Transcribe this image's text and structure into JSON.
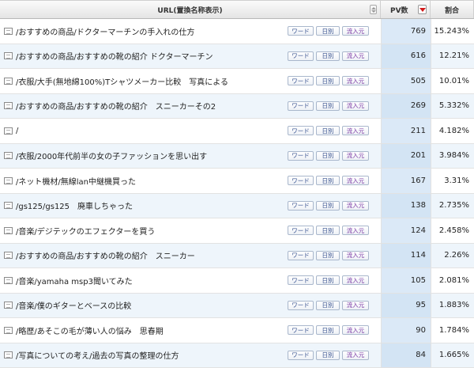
{
  "header": {
    "url_label": "URL(置換名称表示)",
    "pv_label": "PV数",
    "rate_label": "割合"
  },
  "row_buttons": {
    "word": "ワード",
    "daily": "日別",
    "referrer": "流入元"
  },
  "rows": [
    {
      "url": "/おすすめの商品/ドクターマーチンの手入れの仕方",
      "pv": "769",
      "rate": "15.243%"
    },
    {
      "url": "/おすすめの商品/おすすめの靴の紹介 ドクターマーチン",
      "pv": "616",
      "rate": "12.21%"
    },
    {
      "url": "/衣服/大手(無地綿100%)Tシャツメーカー比較　写真による",
      "pv": "505",
      "rate": "10.01%"
    },
    {
      "url": "/おすすめの商品/おすすめの靴の紹介　スニーカーその2",
      "pv": "269",
      "rate": "5.332%"
    },
    {
      "url": "/",
      "pv": "211",
      "rate": "4.182%"
    },
    {
      "url": "/衣服/2000年代前半の女の子ファッションを思い出す",
      "pv": "201",
      "rate": "3.984%"
    },
    {
      "url": "/ネット機材/無線lan中継機買った",
      "pv": "167",
      "rate": "3.31%"
    },
    {
      "url": "/gs125/gs125　廃車しちゃった",
      "pv": "138",
      "rate": "2.735%"
    },
    {
      "url": "/音楽/デジテックのエフェクターを買う",
      "pv": "124",
      "rate": "2.458%"
    },
    {
      "url": "/おすすめの商品/おすすめの靴の紹介　スニーカー",
      "pv": "114",
      "rate": "2.26%"
    },
    {
      "url": "/音楽/yamaha msp3聞いてみた",
      "pv": "105",
      "rate": "2.081%"
    },
    {
      "url": "/音楽/僕のギターとベースの比較",
      "pv": "95",
      "rate": "1.883%"
    },
    {
      "url": "/略歴/あそこの毛が薄い人の悩み　思春期",
      "pv": "90",
      "rate": "1.784%"
    },
    {
      "url": "/写真についての考え/過去の写真の整理の仕方",
      "pv": "84",
      "rate": "1.665%"
    }
  ]
}
